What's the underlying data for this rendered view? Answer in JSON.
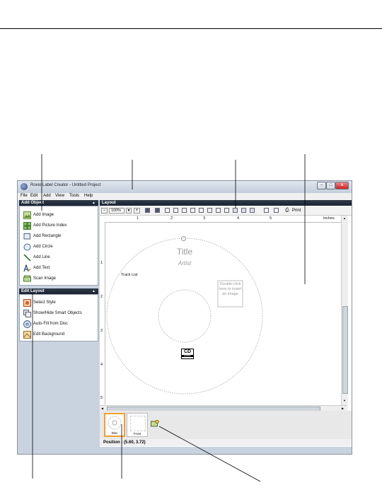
{
  "window": {
    "title": "Roxio Label Creator - Untitled Project",
    "controls": {
      "minimize": "–",
      "maximize": "□",
      "close": "x"
    }
  },
  "menu": [
    "File",
    "Edit",
    "Add",
    "View",
    "Tools",
    "Help"
  ],
  "add_object": {
    "header": "Add Object",
    "items": [
      {
        "label": "Add Image",
        "icon": "image-icon",
        "color": "#7fae3a"
      },
      {
        "label": "Add Picture Index",
        "icon": "picture-index-icon",
        "color": "#4f9a3f"
      },
      {
        "label": "Add Rectangle",
        "icon": "rectangle-icon",
        "color": "#7a8fb0"
      },
      {
        "label": "Add Circle",
        "icon": "circle-icon",
        "color": "#5a7fa8"
      },
      {
        "label": "Add Line",
        "icon": "line-icon",
        "color": "#3f8a3f"
      },
      {
        "label": "Add Text",
        "icon": "text-icon",
        "color": "#2b5aa0"
      },
      {
        "label": "Scan Image",
        "icon": "scanner-icon",
        "color": "#6a9a40"
      }
    ]
  },
  "edit_layout": {
    "header": "Edit Layout",
    "items": [
      {
        "label": "Select Style",
        "icon": "style-icon",
        "color": "#d0602a"
      },
      {
        "label": "Show/Hide Smart Objects",
        "icon": "smart-objects-icon",
        "color": "#808890"
      },
      {
        "label": "Auto-Fill from Disc",
        "icon": "disc-icon",
        "color": "#6a8ab0"
      },
      {
        "label": "Edit Background",
        "icon": "background-icon",
        "color": "#c08a40"
      }
    ]
  },
  "layout": {
    "header": "Layout",
    "zoom": "100%",
    "zoom_out": "−",
    "zoom_in": "+",
    "print_label": "Print",
    "ruler_unit": "inches",
    "ruler_top": [
      "1",
      "2",
      "3",
      "4",
      "5"
    ],
    "ruler_left": [
      "1",
      "2",
      "3",
      "4",
      "5"
    ]
  },
  "disc": {
    "title": "Title",
    "artist": "Artist",
    "track_list": "Track List",
    "image_placeholder": "Double-click here to insert an image",
    "cd_logo": "CD",
    "cd_logo_sub": "AUDIO"
  },
  "thumbnails": [
    {
      "label": "Disc",
      "selected": true
    },
    {
      "label": "Front",
      "selected": false
    }
  ],
  "status": {
    "position": "Position : (5.60, 3.72)"
  },
  "colors": {
    "panel_header": "#1f2836",
    "window_bg": "#c9d3df",
    "selected_border": "#f0a030"
  }
}
